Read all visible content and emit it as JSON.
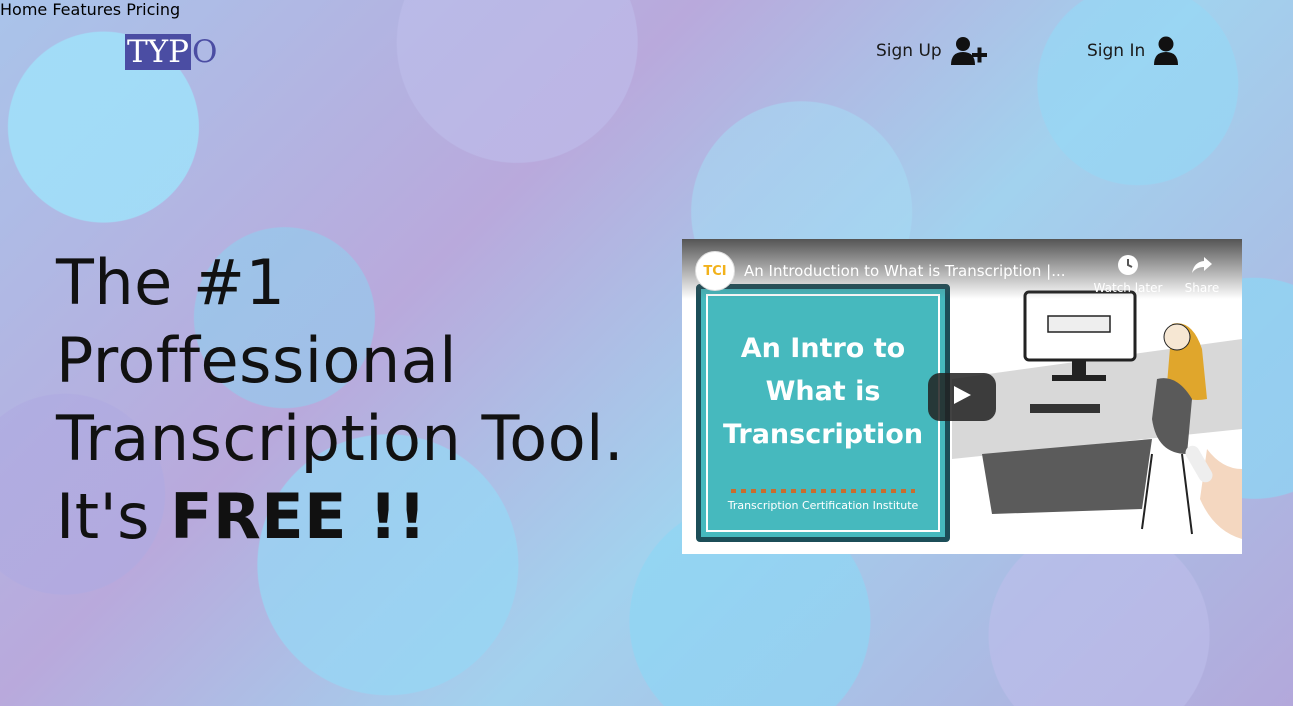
{
  "brand": {
    "logo_box": "TYP",
    "logo_tail": "O"
  },
  "nav": {
    "items": [
      {
        "label": "Home"
      },
      {
        "label": "Features"
      },
      {
        "label": "Pricing"
      }
    ]
  },
  "auth": {
    "sign_up": "Sign Up",
    "sign_in": "Sign In"
  },
  "hero": {
    "line1": "The #1",
    "line2": "Proffessional",
    "line3": "Transcription Tool.",
    "line4_prefix": "It's ",
    "line4_bold": "FREE !!"
  },
  "video": {
    "title": "An Introduction to What is Transcription |...",
    "channel_initials": "TCI",
    "watch_later": "Watch later",
    "share": "Share",
    "card_title_lines": [
      "An Intro to",
      "What is",
      "Transcription"
    ],
    "card_footer": "Transcription Certification Institute"
  },
  "icons": {
    "sign_up": "user-plus-icon",
    "sign_in": "user-icon",
    "play": "play-icon",
    "watch_later": "clock-icon",
    "share": "share-icon"
  },
  "colors": {
    "brand": "#4b4da3",
    "teal": "#46b9be",
    "text": "#111111"
  }
}
